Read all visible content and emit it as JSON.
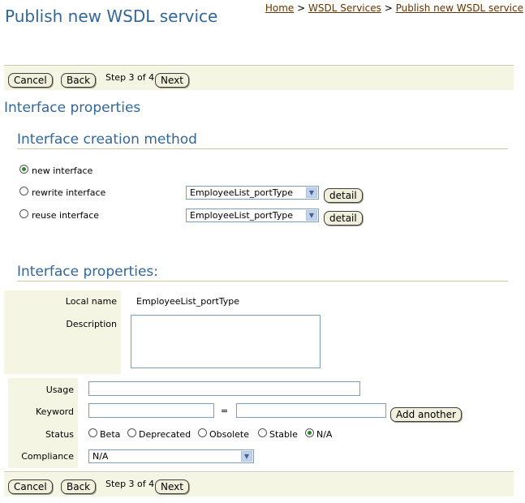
{
  "header": {
    "title": "Publish new WSDL service",
    "breadcrumb": {
      "home": "Home",
      "sep1": ">",
      "wsdl_services": "WSDL Services",
      "sep2": ">",
      "current": "Publish new WSDL service"
    }
  },
  "nav": {
    "cancel": "Cancel",
    "back": "Back",
    "step": "Step 3 of 4",
    "next": "Next"
  },
  "section_title": "Interface properties",
  "creation_method": {
    "title": "Interface creation method",
    "options": [
      {
        "label": "new interface",
        "selected": true
      },
      {
        "label": "rewrite interface",
        "selected": false,
        "select_value": "EmployeeList_portType",
        "detail": "detail"
      },
      {
        "label": "reuse interface",
        "selected": false,
        "select_value": "EmployeeList_portType",
        "detail": "detail"
      }
    ]
  },
  "properties": {
    "title": "Interface properties:",
    "local_name_label": "Local name",
    "local_name_value": "EmployeeList_portType",
    "description_label": "Description"
  },
  "extra": {
    "usage_label": "Usage",
    "keyword_label": "Keyword",
    "equals": "=",
    "add_another": "Add another",
    "status_label": "Status",
    "status_options": [
      {
        "label": "Beta",
        "selected": false
      },
      {
        "label": "Deprecated",
        "selected": false
      },
      {
        "label": "Obsolete",
        "selected": false
      },
      {
        "label": "Stable",
        "selected": false
      },
      {
        "label": "N/A",
        "selected": true
      }
    ],
    "compliance_label": "Compliance",
    "compliance_value": "N/A"
  },
  "icons": {
    "select_arrow": "chevron-down-icon",
    "radio": "radio-icon"
  }
}
